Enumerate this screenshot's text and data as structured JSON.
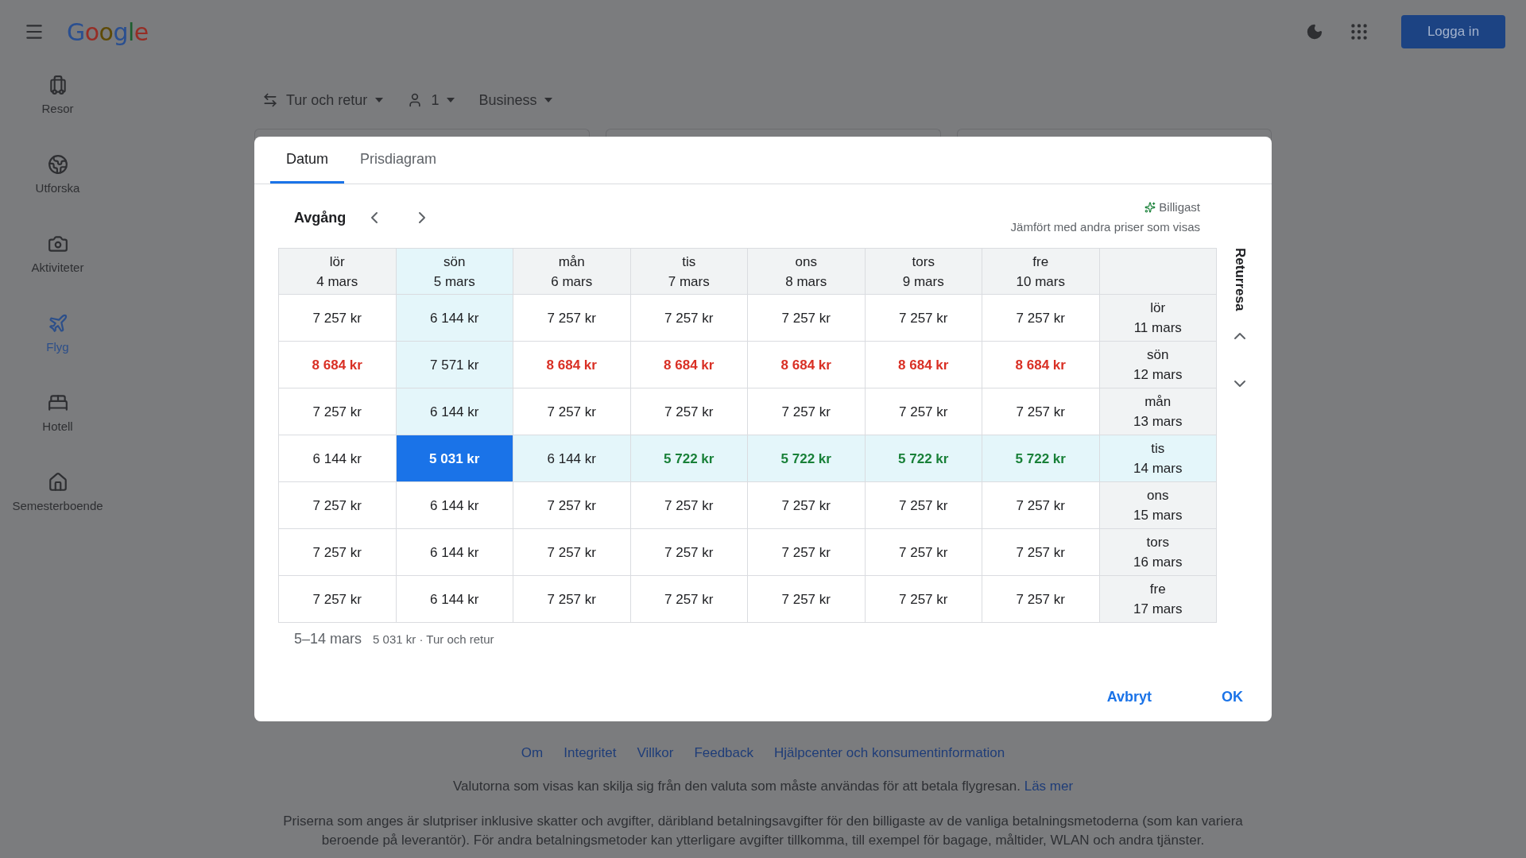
{
  "header": {
    "logo": "Google",
    "sign_in": "Logga in"
  },
  "sidebar": {
    "items": [
      {
        "label": "Resor",
        "kind": "luggage",
        "selected": false
      },
      {
        "label": "Utforska",
        "kind": "explore",
        "selected": false
      },
      {
        "label": "Aktiviteter",
        "kind": "camera",
        "selected": false
      },
      {
        "label": "Flyg",
        "kind": "plane",
        "selected": true
      },
      {
        "label": "Hotell",
        "kind": "bed",
        "selected": false
      },
      {
        "label": "Semesterboende",
        "kind": "home",
        "selected": false
      }
    ]
  },
  "trip_options": [
    {
      "kind": "trip",
      "label": "Tur och retur"
    },
    {
      "kind": "passengers",
      "label": "1"
    },
    {
      "kind": "class",
      "label": "Business"
    }
  ],
  "dialog": {
    "tabs": [
      {
        "label": "Datum",
        "selected": true
      },
      {
        "label": "Prisdiagram",
        "selected": false
      }
    ],
    "departure_label": "Avgång",
    "legend": {
      "label": "Billigast",
      "note": "Jämfört med andra priser som visas"
    },
    "return_label": "Returresa",
    "columns": [
      {
        "day": "lör",
        "date": "4 mars",
        "selected": false
      },
      {
        "day": "sön",
        "date": "5 mars",
        "selected": true
      },
      {
        "day": "mån",
        "date": "6 mars",
        "selected": false
      },
      {
        "day": "tis",
        "date": "7 mars",
        "selected": false
      },
      {
        "day": "ons",
        "date": "8 mars",
        "selected": false
      },
      {
        "day": "tors",
        "date": "9 mars",
        "selected": false
      },
      {
        "day": "fre",
        "date": "10 mars",
        "selected": false
      }
    ],
    "rows": [
      {
        "day": "lör",
        "date": "11 mars",
        "selected": false,
        "cells": [
          {
            "price": "7 257 kr",
            "kind": "normal"
          },
          {
            "price": "6 144 kr",
            "kind": "normal"
          },
          {
            "price": "7 257 kr",
            "kind": "normal"
          },
          {
            "price": "7 257 kr",
            "kind": "normal"
          },
          {
            "price": "7 257 kr",
            "kind": "normal"
          },
          {
            "price": "7 257 kr",
            "kind": "normal"
          },
          {
            "price": "7 257 kr",
            "kind": "normal"
          }
        ]
      },
      {
        "day": "sön",
        "date": "12 mars",
        "selected": false,
        "cells": [
          {
            "price": "8 684 kr",
            "kind": "high"
          },
          {
            "price": "7 571 kr",
            "kind": "normal"
          },
          {
            "price": "8 684 kr",
            "kind": "high"
          },
          {
            "price": "8 684 kr",
            "kind": "high"
          },
          {
            "price": "8 684 kr",
            "kind": "high"
          },
          {
            "price": "8 684 kr",
            "kind": "high"
          },
          {
            "price": "8 684 kr",
            "kind": "high"
          }
        ]
      },
      {
        "day": "mån",
        "date": "13 mars",
        "selected": false,
        "cells": [
          {
            "price": "7 257 kr",
            "kind": "normal"
          },
          {
            "price": "6 144 kr",
            "kind": "normal"
          },
          {
            "price": "7 257 kr",
            "kind": "normal"
          },
          {
            "price": "7 257 kr",
            "kind": "normal"
          },
          {
            "price": "7 257 kr",
            "kind": "normal"
          },
          {
            "price": "7 257 kr",
            "kind": "normal"
          },
          {
            "price": "7 257 kr",
            "kind": "normal"
          }
        ]
      },
      {
        "day": "tis",
        "date": "14 mars",
        "selected": true,
        "cells": [
          {
            "price": "6 144 kr",
            "kind": "normal"
          },
          {
            "price": "5 031 kr",
            "kind": "low"
          },
          {
            "price": "6 144 kr",
            "kind": "normal"
          },
          {
            "price": "5 722 kr",
            "kind": "low"
          },
          {
            "price": "5 722 kr",
            "kind": "low"
          },
          {
            "price": "5 722 kr",
            "kind": "low"
          },
          {
            "price": "5 722 kr",
            "kind": "low"
          }
        ]
      },
      {
        "day": "ons",
        "date": "15 mars",
        "selected": false,
        "cells": [
          {
            "price": "7 257 kr",
            "kind": "normal"
          },
          {
            "price": "6 144 kr",
            "kind": "normal"
          },
          {
            "price": "7 257 kr",
            "kind": "normal"
          },
          {
            "price": "7 257 kr",
            "kind": "normal"
          },
          {
            "price": "7 257 kr",
            "kind": "normal"
          },
          {
            "price": "7 257 kr",
            "kind": "normal"
          },
          {
            "price": "7 257 kr",
            "kind": "normal"
          }
        ]
      },
      {
        "day": "tors",
        "date": "16 mars",
        "selected": false,
        "cells": [
          {
            "price": "7 257 kr",
            "kind": "normal"
          },
          {
            "price": "6 144 kr",
            "kind": "normal"
          },
          {
            "price": "7 257 kr",
            "kind": "normal"
          },
          {
            "price": "7 257 kr",
            "kind": "normal"
          },
          {
            "price": "7 257 kr",
            "kind": "normal"
          },
          {
            "price": "7 257 kr",
            "kind": "normal"
          },
          {
            "price": "7 257 kr",
            "kind": "normal"
          }
        ]
      },
      {
        "day": "fre",
        "date": "17 mars",
        "selected": false,
        "cells": [
          {
            "price": "7 257 kr",
            "kind": "normal"
          },
          {
            "price": "6 144 kr",
            "kind": "normal"
          },
          {
            "price": "7 257 kr",
            "kind": "normal"
          },
          {
            "price": "7 257 kr",
            "kind": "normal"
          },
          {
            "price": "7 257 kr",
            "kind": "normal"
          },
          {
            "price": "7 257 kr",
            "kind": "normal"
          },
          {
            "price": "7 257 kr",
            "kind": "normal"
          }
        ]
      }
    ],
    "summary": {
      "dates": "5–14 mars",
      "detail": "5 031 kr · Tur och retur"
    },
    "buttons": [
      {
        "label": "Avbryt"
      },
      {
        "label": "OK"
      }
    ]
  },
  "footer": {
    "links": [
      "Om",
      "Integritet",
      "Villkor",
      "Feedback",
      "Hjälpcenter och konsumentinformation"
    ],
    "currency_note": "Valutorna som visas kan skilja sig från den valuta som måste användas för att betala flygresan.",
    "currency_link": "Läs mer",
    "price_note": "Priserna som anges är slutpriser inklusive skatter och avgifter, däribland betalningsavgifter för den billigaste av de vanliga betalningsmetoderna (som kan variera beroende på leverantör). För andra betalningsmetoder kan ytterligare avgifter tillkomma, till exempel för bagage, måltider, WLAN och andra tjänster."
  }
}
